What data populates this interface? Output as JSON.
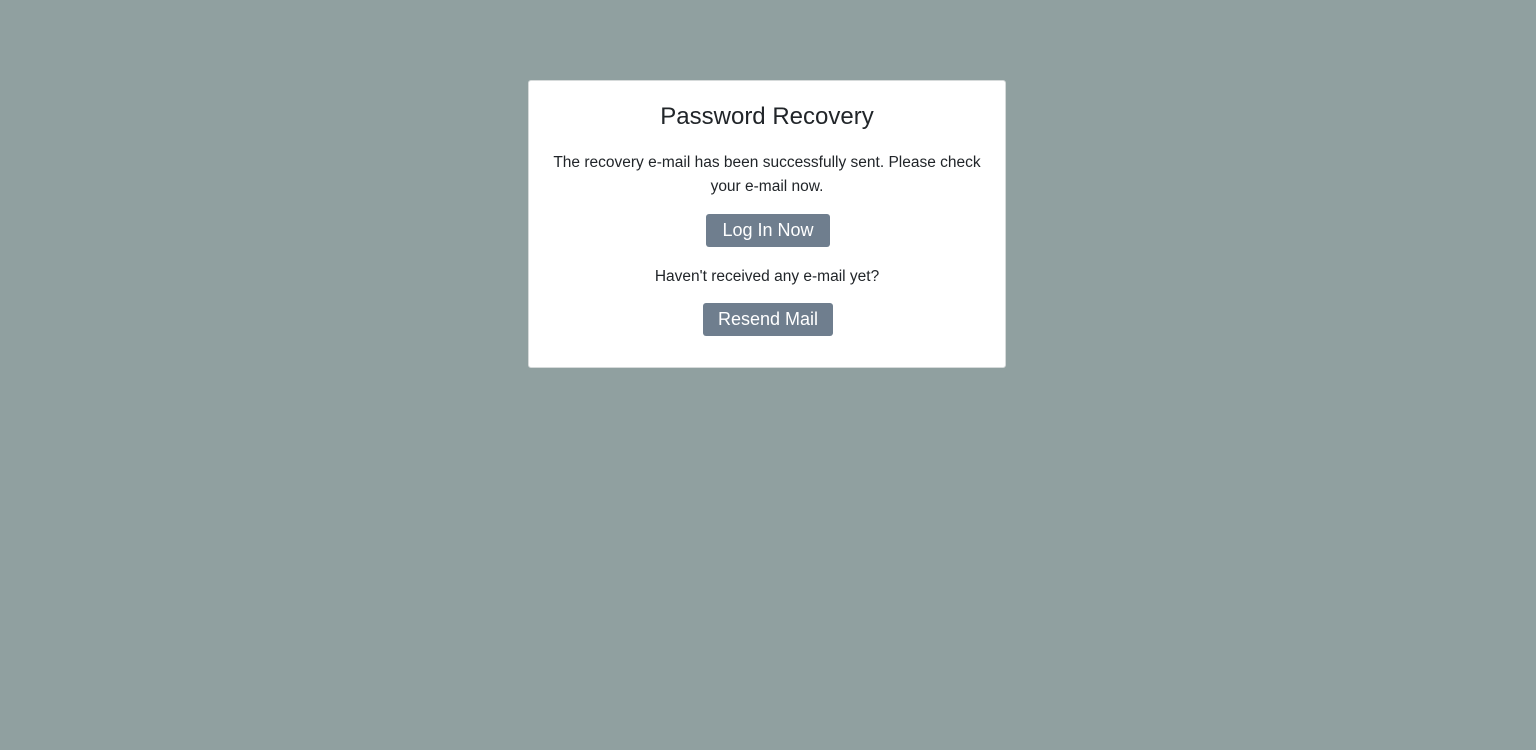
{
  "card": {
    "title": "Password Recovery",
    "message": "The recovery e-mail has been successfully sent. Please check your e-mail now.",
    "login_button_label": "Log In Now",
    "question": "Haven't received any e-mail yet?",
    "resend_button_label": "Resend Mail"
  },
  "colors": {
    "background": "#90a0a0",
    "card": "#ffffff",
    "button": "#6f7e8e",
    "text": "#212529"
  }
}
